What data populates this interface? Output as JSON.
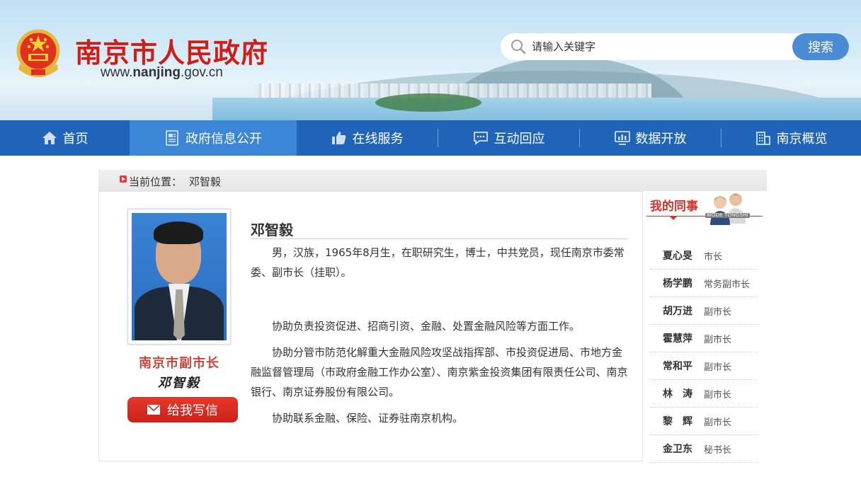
{
  "header": {
    "site_title": "南京市人民政府",
    "site_url_prefix": "www.",
    "site_url_domain": "nanjing",
    "site_url_suffix": ".gov.cn",
    "search_placeholder": "请输入关键字",
    "search_button": "搜索"
  },
  "nav": {
    "items": [
      {
        "label": "首页",
        "icon": "home-icon"
      },
      {
        "label": "政府信息公开",
        "icon": "document-icon",
        "active": true
      },
      {
        "label": "在线服务",
        "icon": "thumbs-up-icon"
      },
      {
        "label": "互动回应",
        "icon": "chat-icon"
      },
      {
        "label": "数据开放",
        "icon": "monitor-icon"
      },
      {
        "label": "南京概览",
        "icon": "building-icon"
      }
    ]
  },
  "breadcrumb": {
    "label": "当前位置：",
    "current": "邓智毅"
  },
  "profile": {
    "title": "南京市副市长",
    "signature": "邓智毅",
    "write_button": "给我写信",
    "name": "邓智毅",
    "bio": [
      "男，汉族，1965年8月生，在职研究生，博士，中共党员，现任南京市委常委、副市长（挂职）。",
      "协助负责投资促进、招商引资、金融、处置金融风险等方面工作。",
      "协助分管市防范化解重大金融风险攻坚战指挥部、市投资促进局、市地方金融监督管理局（市政府金融工作办公室）、南京紫金投资集团有限责任公司、南京银行、南京证券股份有限公司。",
      "协助联系金融、保险、证券驻南京机构。"
    ]
  },
  "sidebar": {
    "heading": "我的同事",
    "badge": "WODE TONGSHI",
    "colleagues": [
      {
        "name": "夏心旻",
        "role": "市长"
      },
      {
        "name": "杨学鹏",
        "role": "常务副市长"
      },
      {
        "name": "胡万进",
        "role": "副市长"
      },
      {
        "name": "霍慧萍",
        "role": "副市长"
      },
      {
        "name": "常和平",
        "role": "副市长"
      },
      {
        "name": "林　涛",
        "role": "副市长"
      },
      {
        "name": "黎　辉",
        "role": "副市长"
      },
      {
        "name": "金卫东",
        "role": "秘书长"
      }
    ]
  },
  "colors": {
    "brand_red": "#cf1e17",
    "nav_blue": "#1f64b8",
    "nav_active": "#3c86d8",
    "search_button": "#4a8bd5"
  }
}
